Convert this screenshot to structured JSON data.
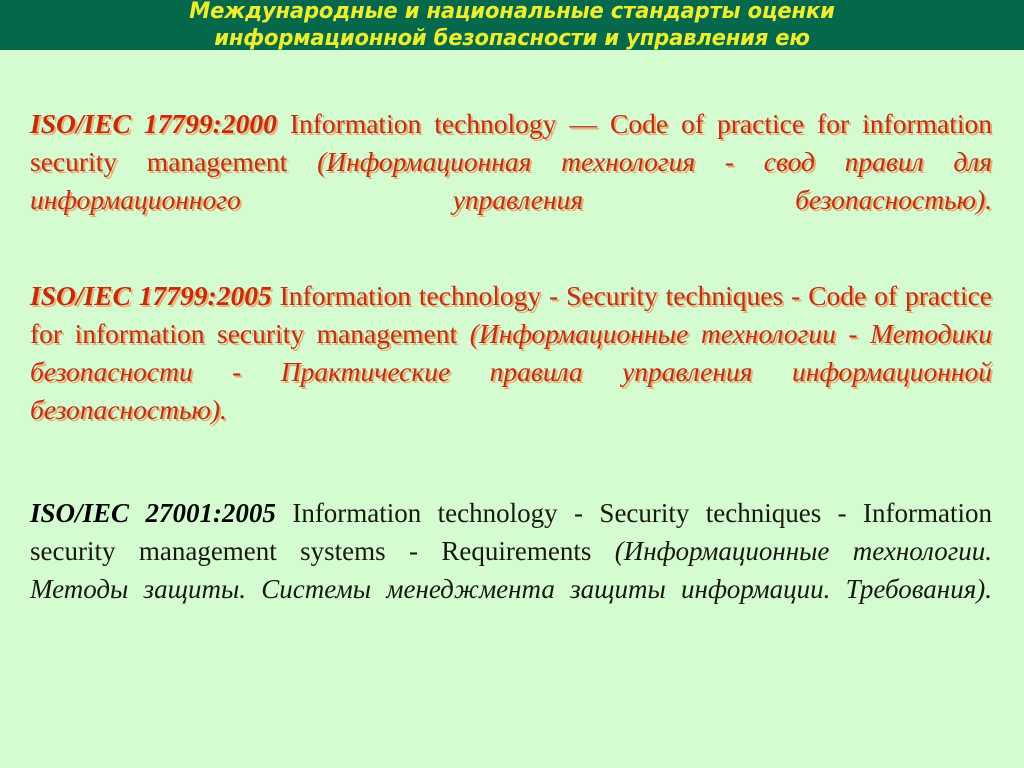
{
  "slide": {
    "background_color": "#d4fcd0",
    "header": {
      "band_color": "#06684a",
      "text_color": "#ecee2f",
      "line1": "Международные и национальные стандарты оценки",
      "line2": "информационной безопасности и управления ею"
    },
    "accent_colors": {
      "red_text": "#bf2f16",
      "red_shadow": "#ec9e60",
      "black_text": "#17190f"
    },
    "standards": [
      {
        "id": "iso-17799-2000",
        "color": "red",
        "code": "ISO/IEC 17799:2000",
        "title_en": "Information technology — Code of practice for information security management",
        "title_ru": "(Информационная технология - свод правил для информационного управления безопасностью)."
      },
      {
        "id": "iso-17799-2005",
        "color": "red",
        "code": "ISO/IEC 17799:2005",
        "title_en": "Information technology - Security techniques - Code of practice for information security management",
        "title_ru": "(Информационные технологии - Методики безопасности - Практические правила управления информационной безопасностью)."
      },
      {
        "id": "iso-27001-2005",
        "color": "black",
        "code": "ISO/IEC 27001:2005",
        "title_en": "Information technology - Security techniques - Information security management systems - Requirements",
        "title_ru": "(Информационные технологии. Методы защиты. Системы менеджмента защиты информации. Требования)."
      }
    ]
  }
}
